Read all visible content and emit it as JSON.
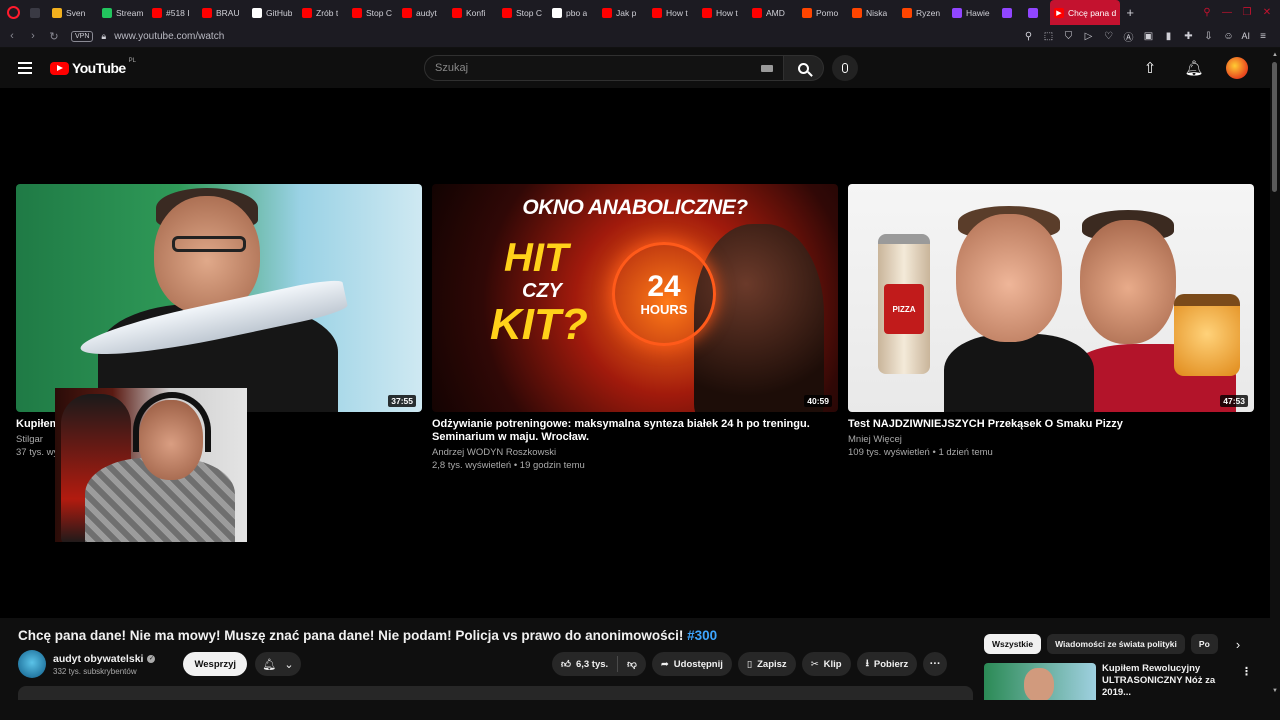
{
  "browser": {
    "tabs": [
      {
        "label": "",
        "color": "#3a3a44",
        "icon": "opera-menu-icon"
      },
      {
        "label": "Sven",
        "color": "#f2b01e",
        "icon": "crown-icon"
      },
      {
        "label": "Stream",
        "color": "#22c55e",
        "icon": "kick-icon"
      },
      {
        "label": "#518 I",
        "color": "#ff0000",
        "icon": "youtube-icon"
      },
      {
        "label": "BRAU",
        "color": "#ff0000",
        "icon": "youtube-icon"
      },
      {
        "label": "GitHub",
        "color": "#ffffff",
        "icon": "github-icon"
      },
      {
        "label": "Zrób t",
        "color": "#ff0000",
        "icon": "youtube-icon"
      },
      {
        "label": "Stop C",
        "color": "#ff0000",
        "icon": "youtube-icon"
      },
      {
        "label": "audyt",
        "color": "#ff0000",
        "icon": "youtube-icon"
      },
      {
        "label": "Konfi",
        "color": "#ff0000",
        "icon": "youtube-icon"
      },
      {
        "label": "Stop C",
        "color": "#ff0000",
        "icon": "youtube-icon"
      },
      {
        "label": "pbo a",
        "color": "#ffffff",
        "icon": "google-icon"
      },
      {
        "label": "Jak p",
        "color": "#ff0000",
        "icon": "youtube-icon"
      },
      {
        "label": "How t",
        "color": "#ff0000",
        "icon": "youtube-icon"
      },
      {
        "label": "How t",
        "color": "#ff0000",
        "icon": "youtube-icon"
      },
      {
        "label": "AMD",
        "color": "#ff0000",
        "icon": "youtube-icon"
      },
      {
        "label": "Pomo",
        "color": "#ff4500",
        "icon": "reddit-icon"
      },
      {
        "label": "Niska",
        "color": "#ff4500",
        "icon": "reddit-icon"
      },
      {
        "label": "Ryzen",
        "color": "#ff4500",
        "icon": "reddit-icon"
      },
      {
        "label": "Hawie",
        "color": "#9146ff",
        "icon": "twitch-icon"
      },
      {
        "label": "",
        "color": "#9146ff",
        "icon": "twitch-icon"
      },
      {
        "label": "",
        "color": "#9146ff",
        "icon": "twitch-icon"
      }
    ],
    "active_tab": "Chcę pana d",
    "url": "www.youtube.com/watch",
    "vpn": "VPN",
    "ai_label": "AI"
  },
  "youtube": {
    "logo": "YouTube",
    "country": "PL",
    "search_placeholder": "Szukaj"
  },
  "end_screen": [
    {
      "title": "Kupiłem Re                  Nóż za 2019 zł",
      "channel": "Stilgar",
      "stats": "37 tys. wy",
      "duration": "37:55"
    },
    {
      "title": "Odżywianie potreningowe: maksymalna synteza białek 24 h po treningu. Seminarium w maju. Wrocław.",
      "channel": "Andrzej WODYN Roszkowski",
      "stats": "2,8 tys. wyświetleń • 19 godzin temu",
      "duration": "40:59",
      "thumb_heading": "OKNO ANABOLICZNE?",
      "thumb_hit": "HIT",
      "thumb_czy": "CZY",
      "thumb_kit": "KIT?",
      "thumb_clock_num": "24",
      "thumb_clock_unit": "HOURS"
    },
    {
      "title": "Test NAJDZIWNIEJSZYCH Przekąsek O Smaku Pizzy",
      "channel": "Mniej Więcej",
      "stats": "109 tys. wyświetleń • 1 dzień temu",
      "duration": "47:53",
      "thumb_label": "PIZZA"
    }
  ],
  "video": {
    "title": "Chcę pana dane! Nie ma mowy! Muszę znać pana dane! Nie podam! Policja vs prawo do anonimowości!",
    "hashtag": "#300",
    "channel_name": "audyt obywatelski",
    "subscribers": "332 tys. subskrybentów",
    "support_label": "Wesprzyj",
    "likes": "6,3 tys.",
    "share_label": "Udostępnij",
    "save_label": "Zapisz",
    "clip_label": "Klip",
    "download_label": "Pobierz"
  },
  "sidebar": {
    "chips": [
      "Wszystkie",
      "Wiadomości ze świata polityki",
      "Po"
    ],
    "recommendation_title": "Kupiłem Rewolucyjny ULTRASONICZNY Nóż za 2019..."
  }
}
